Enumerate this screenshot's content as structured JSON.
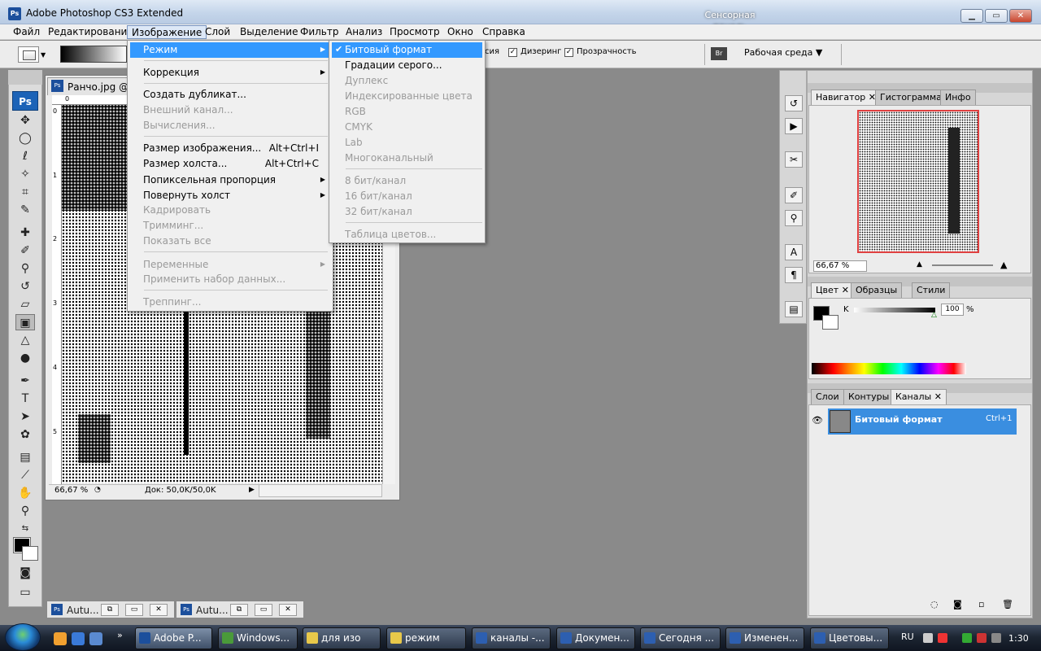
{
  "window": {
    "app_icon": "Ps",
    "title": "Adobe Photoshop CS3 Extended",
    "touch_panel": "Сенсорная панель",
    "min_icon": "minimize-icon",
    "max_icon": "maximize-icon",
    "close_icon": "close-icon"
  },
  "menubar": [
    "Файл",
    "Редактирование",
    "Изображение",
    "Слой",
    "Выделение",
    "Фильтр",
    "Анализ",
    "Просмотр",
    "Окно",
    "Справка"
  ],
  "options": {
    "cb1_label": "сия",
    "cb2_label": "Дизеринг",
    "cb3_label": "Прозрачность",
    "workspace": "Рабочая среда ▼",
    "bridge_icon": "Br"
  },
  "tools": {
    "ps_logo": "Ps",
    "icons": [
      "move-icon",
      "marquee-icon",
      "lasso-icon",
      "magic-wand-icon",
      "crop-icon",
      "slice-icon",
      "healing-icon",
      "brush-icon",
      "clone-stamp-icon",
      "history-brush-icon",
      "eraser-icon",
      "gradient-icon",
      "blur-icon",
      "dodge-icon",
      "pen-icon",
      "type-icon",
      "path-select-icon",
      "shape-icon",
      "notes-icon",
      "eyedropper-icon",
      "hand-icon",
      "zoom-icon"
    ]
  },
  "document": {
    "icon": "Ps",
    "title": "Ранчо.jpg @",
    "ruler_top": "0",
    "ruler_left": [
      "0",
      "1",
      "2",
      "3",
      "4",
      "5"
    ],
    "zoom": "66,67 %",
    "info": "Док: 50,0K/50,0K"
  },
  "minimized": [
    {
      "title": "Autu..."
    },
    {
      "title": "Autu..."
    }
  ],
  "image_menu": {
    "items": [
      {
        "label": "Режим",
        "submenu": true,
        "state": "highlighted"
      },
      {
        "label": "Коррекция",
        "submenu": true
      },
      {
        "label": "Создать дубликат..."
      },
      {
        "label": "Внешний канал...",
        "disabled": true
      },
      {
        "label": "Вычисления...",
        "disabled": true
      },
      {
        "label": "Размер изображения...",
        "shortcut": "Alt+Ctrl+I"
      },
      {
        "label": "Размер холста...",
        "shortcut": "Alt+Ctrl+C"
      },
      {
        "label": "Попиксельная пропорция",
        "submenu": true
      },
      {
        "label": "Повернуть холст",
        "submenu": true
      },
      {
        "label": "Кадрировать",
        "disabled": true
      },
      {
        "label": "Тримминг...",
        "disabled": true
      },
      {
        "label": "Показать все",
        "disabled": true
      },
      {
        "label": "Переменные",
        "submenu": true,
        "disabled": true
      },
      {
        "label": "Применить набор данных...",
        "disabled": true
      },
      {
        "label": "Треппинг...",
        "disabled": true
      }
    ]
  },
  "mode_submenu": {
    "items": [
      {
        "label": "Битовый формат",
        "checked": true,
        "state": "highlighted"
      },
      {
        "label": "Градации серого..."
      },
      {
        "label": "Дуплекс",
        "disabled": true
      },
      {
        "label": "Индексированные цвета",
        "disabled": true
      },
      {
        "label": "RGB",
        "disabled": true
      },
      {
        "label": "CMYK",
        "disabled": true
      },
      {
        "label": "Lab",
        "disabled": true
      },
      {
        "label": "Многоканальный",
        "disabled": true
      },
      {
        "label": "8 бит/канал",
        "disabled": true
      },
      {
        "label": "16 бит/канал",
        "disabled": true
      },
      {
        "label": "32 бит/канал",
        "disabled": true
      },
      {
        "label": "Таблица цветов...",
        "disabled": true
      }
    ]
  },
  "navigator_panel": {
    "tabs": [
      "Навигатор",
      "Гистограмма",
      "Инфо"
    ],
    "zoom": "66,67 %"
  },
  "color_panel": {
    "tabs": [
      "Цвет",
      "Образцы",
      "Стили"
    ],
    "channel_label": "K",
    "value": "100",
    "unit": "%",
    "k_percent": 100
  },
  "channels_panel": {
    "tabs": [
      "Слои",
      "Контуры",
      "Каналы"
    ],
    "channel_name": "Битовый формат",
    "shortcut": "Ctrl+1"
  },
  "taskbar": {
    "buttons": [
      {
        "label": "Adobe P...",
        "icon_color": "#1c4f9c",
        "active": true
      },
      {
        "label": "Windows...",
        "icon_color": "#4a9a3a"
      },
      {
        "label": "для изо",
        "icon_color": "#e8c84a"
      },
      {
        "label": "режим",
        "icon_color": "#e8c84a"
      },
      {
        "label": "каналы -...",
        "icon_color": "#2d5fb0"
      },
      {
        "label": "Докумен...",
        "icon_color": "#2d5fb0"
      },
      {
        "label": "Сегодня ...",
        "icon_color": "#2d5fb0"
      },
      {
        "label": "Изменен...",
        "icon_color": "#2d5fb0"
      },
      {
        "label": "Цветовы...",
        "icon_color": "#2d5fb0"
      }
    ],
    "lang": "RU",
    "clock": "1:30"
  },
  "colors": {
    "menu_highlight": "#3399ff",
    "channel_selected": "#3a8ee0",
    "navigator_frame": "#e04040"
  }
}
